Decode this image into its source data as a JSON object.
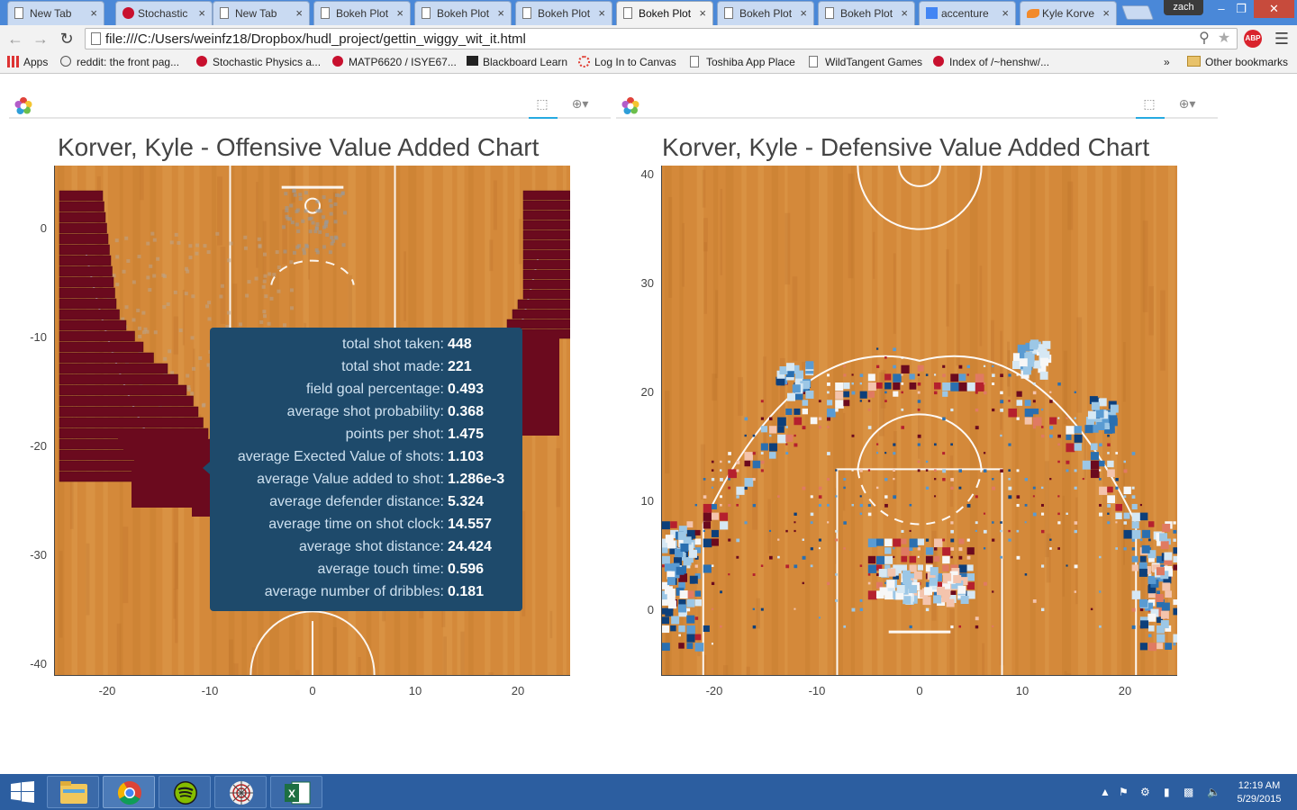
{
  "browser": {
    "tabs": [
      {
        "label": "New Tab",
        "icon": "blank-page-icon",
        "active": false
      },
      {
        "label": "Stochastic",
        "icon": "rpi-icon",
        "active": false
      },
      {
        "label": "New Tab",
        "icon": "blank-page-icon",
        "active": false
      },
      {
        "label": "Bokeh Plot",
        "icon": "page-icon",
        "active": false
      },
      {
        "label": "Bokeh Plot",
        "icon": "page-icon",
        "active": false
      },
      {
        "label": "Bokeh Plot",
        "icon": "page-icon",
        "active": false
      },
      {
        "label": "Bokeh Plot",
        "icon": "page-icon",
        "active": true
      },
      {
        "label": "Bokeh Plot",
        "icon": "page-icon",
        "active": false
      },
      {
        "label": "Bokeh Plot",
        "icon": "page-icon",
        "active": false
      },
      {
        "label": "accenture",
        "icon": "google-icon",
        "active": false
      },
      {
        "label": "Kyle Korve",
        "icon": "fish-icon",
        "active": false
      }
    ],
    "close_glyph": "×",
    "user_name": "zach",
    "window_buttons": {
      "minimize": "–",
      "maximize": "❐",
      "close": "✕"
    },
    "url": "file:///C:/Users/weinfz18/Dropbox/hudl_project/gettin_wiggy_wit_it.html",
    "abp_label": "ABP",
    "bookmarks": [
      {
        "label": "Apps",
        "icon": "apps-grid-icon"
      },
      {
        "label": "reddit: the front pag...",
        "icon": "reddit-icon"
      },
      {
        "label": "Stochastic Physics a...",
        "icon": "rpi-icon"
      },
      {
        "label": "MATP6620 / ISYE67...",
        "icon": "rpi-icon"
      },
      {
        "label": "Blackboard Learn",
        "icon": "blackboard-icon"
      },
      {
        "label": "Log In to Canvas",
        "icon": "canvas-icon"
      },
      {
        "label": "Toshiba App Place",
        "icon": "page-icon"
      },
      {
        "label": "WildTangent Games",
        "icon": "page-icon"
      },
      {
        "label": "Index of /~henshw/...",
        "icon": "rpi-icon"
      }
    ],
    "bookmarks_overflow": "»",
    "other_bookmarks": "Other bookmarks"
  },
  "plots": {
    "offensive": {
      "title": "Korver, Kyle - Offensive Value Added Chart",
      "x_ticks": [
        "-20",
        "-10",
        "0",
        "10",
        "20"
      ],
      "y_ticks": [
        "0",
        "-10",
        "-20",
        "-30",
        "-40"
      ],
      "tooltip": [
        {
          "label": "total shot taken:",
          "value": "448"
        },
        {
          "label": "total shot made:",
          "value": "221"
        },
        {
          "label": "field goal percentage:",
          "value": "0.493"
        },
        {
          "label": "average shot probability:",
          "value": "0.368"
        },
        {
          "label": "points per shot:",
          "value": "1.475"
        },
        {
          "label": "average Exected Value of shots:",
          "value": "1.103"
        },
        {
          "label": "average Value added to shot:",
          "value": "1.286e-3"
        },
        {
          "label": "average defender distance:",
          "value": "5.324"
        },
        {
          "label": "average time on shot clock:",
          "value": "14.557"
        },
        {
          "label": "average shot distance:",
          "value": "24.424"
        },
        {
          "label": "average touch time:",
          "value": "0.596"
        },
        {
          "label": "average number of dribbles:",
          "value": "0.181"
        }
      ]
    },
    "defensive": {
      "title": "Korver, Kyle - Defensive Value Added Chart",
      "x_ticks": [
        "-20",
        "-10",
        "0",
        "10",
        "20"
      ],
      "y_ticks": [
        "40",
        "30",
        "20",
        "10",
        "0"
      ]
    },
    "colors": {
      "court_wood": "#d4893a",
      "court_wood_light": "#e3a257",
      "hex_dark_red": "#6b0a1e",
      "tooltip_bg": "#1e4a6b"
    }
  },
  "taskbar": {
    "apps": [
      {
        "name": "file-explorer",
        "icon": "folder-icon"
      },
      {
        "name": "chrome",
        "icon": "chrome-icon"
      },
      {
        "name": "spotify",
        "icon": "spotify-icon"
      },
      {
        "name": "web-app",
        "icon": "spider-web-icon"
      },
      {
        "name": "excel",
        "icon": "excel-icon"
      }
    ],
    "time": "12:19 AM",
    "date": "5/29/2015"
  }
}
